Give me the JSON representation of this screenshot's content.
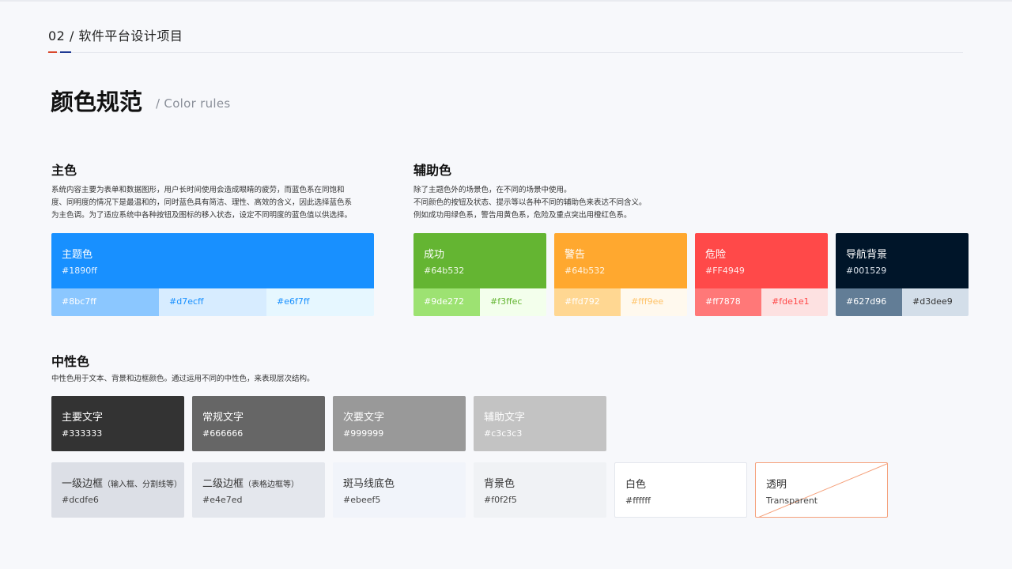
{
  "header": {
    "title": "02 / 软件平台设计项目",
    "accent_colors": [
      "#d9482c",
      "#1f3a93"
    ]
  },
  "page": {
    "title": "颜色规范",
    "subtitle": "/ Color rules"
  },
  "primary": {
    "title": "主色",
    "desc": [
      "系统内容主要为表单和数据图形，用户长时间使用会造成眼睛的疲劳，而蓝色系在同饱和",
      "度、同明度的情况下是最温和的，同时蓝色具有简洁、理性、高效的含义，因此选择蓝色系",
      "为主色调。为了适应系统中各种按钮及图标的移入状态，设定不同明度的蓝色值以供选择。"
    ],
    "card": {
      "name": "主题色",
      "hex": "#1890ff",
      "color": "#1890ff",
      "tints": [
        {
          "hex": "#8bc7ff",
          "color": "#8bc7ff",
          "text_color": "#ffffff"
        },
        {
          "hex": "#d7ecff",
          "color": "#d7ecff",
          "text_color": "#1890ff"
        },
        {
          "hex": "#e6f7ff",
          "color": "#e6f7ff",
          "text_color": "#1890ff"
        }
      ]
    }
  },
  "secondary": {
    "title": "辅助色",
    "desc": [
      "除了主题色外的场景色，在不同的场景中使用。",
      "不同颜色的按钮及状态、提示等以各种不同的辅助色来表达不同含义。",
      "例如成功用绿色系，警告用黄色系，危险及重点突出用橙红色系。"
    ],
    "cards": [
      {
        "name": "成功",
        "hex": "#64b532",
        "color": "#64b532",
        "tints": [
          {
            "hex": "#9de272",
            "color": "#9de272",
            "text_color": "#ffffff"
          },
          {
            "hex": "#f3ffec",
            "color": "#f3ffec",
            "text_color": "#64b532"
          }
        ]
      },
      {
        "name": "警告",
        "hex": "#64b532",
        "color": "#ffa82f",
        "tints": [
          {
            "hex": "#ffd792",
            "color": "#ffd792",
            "text_color": "#ffffff"
          },
          {
            "hex": "#fff9ee",
            "color": "#fff9ee",
            "text_color": "#ffc46b"
          }
        ]
      },
      {
        "name": "危险",
        "hex": "#FF4949",
        "color": "#ff4949",
        "tints": [
          {
            "hex": "#ff7878",
            "color": "#ff7878",
            "text_color": "#ffffff"
          },
          {
            "hex": "#fde1e1",
            "color": "#fde1e1",
            "text_color": "#ff4949"
          }
        ]
      },
      {
        "name": "导航背景",
        "hex": "#001529",
        "color": "#001529",
        "tints": [
          {
            "hex": "#627d96",
            "color": "#627d96",
            "text_color": "#ffffff"
          },
          {
            "hex": "#d3dee9",
            "color": "#d3dee9",
            "text_color": "#333333"
          }
        ]
      }
    ]
  },
  "neutral": {
    "title": "中性色",
    "desc": "中性色用于文本、背景和边框颜色。通过运用不同的中性色，来表现层次结构。",
    "row1": [
      {
        "name": "主要文字",
        "hex": "#333333",
        "color": "#333333",
        "text_color": "#ffffff"
      },
      {
        "name": "常规文字",
        "hex": "#666666",
        "color": "#666666",
        "text_color": "#ffffff"
      },
      {
        "name": "次要文字",
        "hex": "#999999",
        "color": "#999999",
        "text_color": "#ffffff"
      },
      {
        "name": "辅助文字",
        "hex": "#c3c3c3",
        "color": "#c3c3c3",
        "text_color": "#ffffff"
      }
    ],
    "row2": [
      {
        "name": "一级边框",
        "note": "（输入框、分割线等）",
        "hex": "#dcdfe6",
        "color": "#dcdfe6",
        "text_color": "#333333"
      },
      {
        "name": "二级边框",
        "note": "（表格边框等）",
        "hex": "#e4e7ed",
        "color": "#e4e7ed",
        "text_color": "#333333"
      },
      {
        "name": "斑马线底色",
        "note": "",
        "hex": "#ebeef5",
        "color": "#f1f4fa",
        "text_color": "#333333"
      },
      {
        "name": "背景色",
        "note": "",
        "hex": "#f0f2f5",
        "color": "#f0f2f5",
        "text_color": "#333333"
      },
      {
        "name": "白色",
        "note": "",
        "hex": "#ffffff",
        "color": "#ffffff",
        "text_color": "#333333",
        "border": "#e4e7ed"
      },
      {
        "name": "透明",
        "note": "",
        "hex": "Transparent",
        "color": "#ffffff",
        "text_color": "#333333",
        "border": "#f5a07a"
      }
    ]
  }
}
